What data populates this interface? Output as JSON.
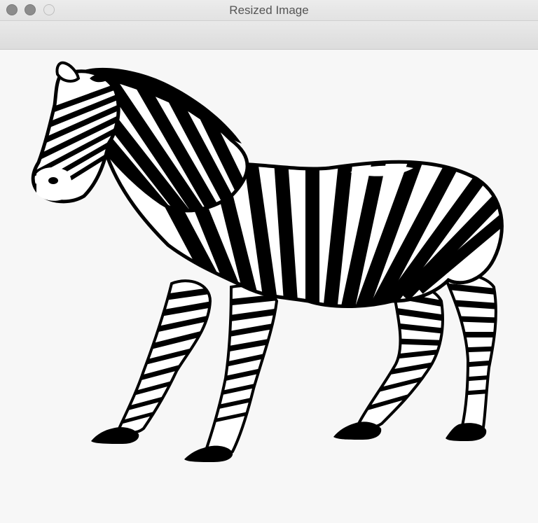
{
  "window": {
    "title": "Resized Image",
    "controls": {
      "close": "close-button",
      "minimize": "minimize-button",
      "zoom": "zoom-button"
    }
  },
  "image": {
    "subject": "zebra",
    "colors": {
      "ink": "#000000",
      "paper": "#ffffff",
      "background": "#f7f7f7"
    }
  }
}
